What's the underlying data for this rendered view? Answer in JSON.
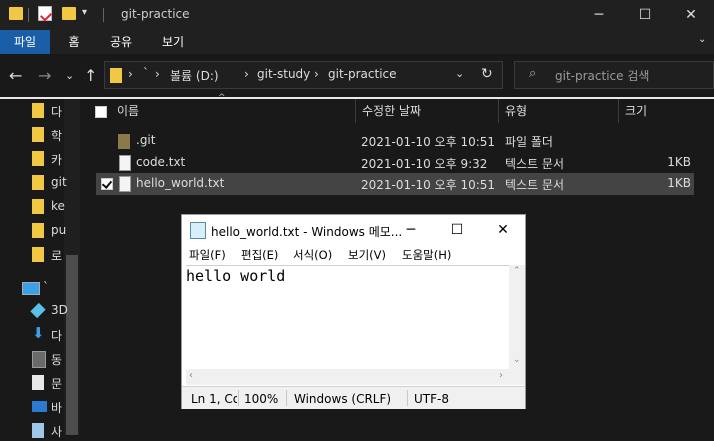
{
  "window": {
    "title": "git-practice"
  },
  "ribbon": {
    "tabs": [
      "파일",
      "홈",
      "공유",
      "보기"
    ]
  },
  "address": {
    "separator_glyph": "`",
    "crumbs": [
      "볼륨 (D:)",
      "git-study",
      "git-practice"
    ]
  },
  "search": {
    "placeholder": "git-practice 검색"
  },
  "nav": {
    "items": [
      {
        "label": "다",
        "icon": "folder-icon"
      },
      {
        "label": "학",
        "icon": "folder-icon"
      },
      {
        "label": "카",
        "icon": "folder-icon"
      },
      {
        "label": "git",
        "icon": "folder-icon"
      },
      {
        "label": "ke",
        "icon": "folder-icon"
      },
      {
        "label": "pu",
        "icon": "folder-icon"
      },
      {
        "label": "로",
        "icon": "folder-icon"
      },
      {
        "label": "`",
        "icon": "computer-icon"
      },
      {
        "label": "3D",
        "icon": "cube-icon"
      },
      {
        "label": "다",
        "icon": "download-icon"
      },
      {
        "label": "동",
        "icon": "video-icon"
      },
      {
        "label": "문",
        "icon": "document-icon"
      },
      {
        "label": "바",
        "icon": "desktop-icon"
      },
      {
        "label": "사",
        "icon": "picture-icon"
      }
    ]
  },
  "columns": {
    "name": "이름",
    "date": "수정한 날짜",
    "type": "유형",
    "size": "크기"
  },
  "files": [
    {
      "name": ".git",
      "date": "2021-01-10 오후 10:51",
      "type": "파일 폴더",
      "size": "",
      "icon": "folder-icon"
    },
    {
      "name": "code.txt",
      "date": "2021-01-10 오후 9:32",
      "type": "텍스트 문서",
      "size": "1KB",
      "icon": "text-file-icon"
    },
    {
      "name": "hello_world.txt",
      "date": "2021-01-10 오후 10:51",
      "type": "텍스트 문서",
      "size": "1KB",
      "icon": "text-file-icon",
      "selected": true
    }
  ],
  "notepad": {
    "title": "hello_world.txt - Windows 메모...",
    "menu": [
      "파일(F)",
      "편집(E)",
      "서식(O)",
      "보기(V)",
      "도움말(H)"
    ],
    "content": "hello world",
    "status": {
      "position": "Ln 1, Co",
      "zoom": "100%",
      "line_ending": "Windows (CRLF)",
      "encoding": "UTF-8"
    }
  },
  "colors": {
    "accent": "#1b5ea8",
    "folder": "#f2c744",
    "selection": "#444444"
  }
}
